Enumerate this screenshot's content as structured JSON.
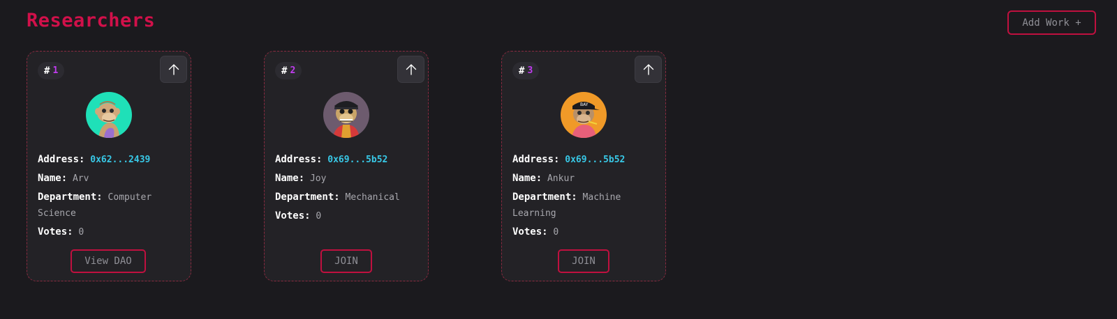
{
  "header": {
    "title": "Researchers",
    "add_work_label": "Add Work +"
  },
  "colors": {
    "accent": "#d1104a",
    "address": "#38c8e6",
    "rank_number": "#c13cf0",
    "background": "#1b1a1e",
    "card": "#232226"
  },
  "cards": [
    {
      "rank_symbol": "#",
      "rank": "1",
      "address_label": "Address:",
      "address": "0x62...2439",
      "name_label": "Name:",
      "name": "Arv",
      "department_label": "Department:",
      "department": "Computer Science",
      "votes_label": "Votes:",
      "votes": "0",
      "action_label": "View DAO",
      "avatar_bg": "#1fe0b8"
    },
    {
      "rank_symbol": "#",
      "rank": "2",
      "address_label": "Address:",
      "address": "0x69...5b52",
      "name_label": "Name:",
      "name": "Joy",
      "department_label": "Department:",
      "department": "Mechanical",
      "votes_label": "Votes:",
      "votes": "0",
      "action_label": "JOIN",
      "avatar_bg": "#6d5b6e"
    },
    {
      "rank_symbol": "#",
      "rank": "3",
      "address_label": "Address:",
      "address": "0x69...5b52",
      "name_label": "Name:",
      "name": "Ankur",
      "department_label": "Department:",
      "department": "Machine Learning",
      "votes_label": "Votes:",
      "votes": "0",
      "action_label": "JOIN",
      "avatar_bg": "#f09a28"
    }
  ]
}
